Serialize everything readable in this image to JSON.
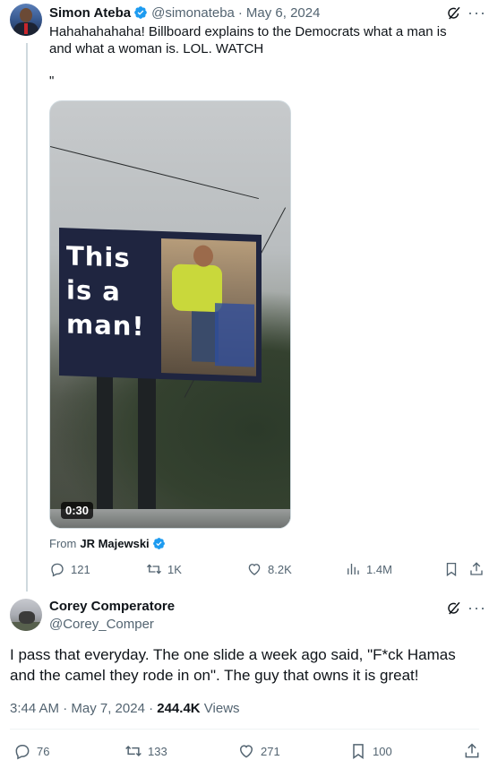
{
  "tweet1": {
    "author_name": "Simon Ateba",
    "handle": "@simonateba",
    "separator": "·",
    "date": "May 6, 2024",
    "text": "Hahahahahaha! Billboard explains to the Democrats what a man is and what a woman is. LOL. WATCH",
    "quote_mark": "\"",
    "video": {
      "billboard_text": "This is a man!",
      "duration": "0:30"
    },
    "from_label": "From",
    "from_name": "JR Majewski",
    "actions": {
      "replies": "121",
      "reposts": "1K",
      "likes": "8.2K",
      "views": "1.4M"
    }
  },
  "tweet2": {
    "author_name": "Corey Comperatore",
    "handle": "@Corey_Comper",
    "text": "I pass that everyday. The one slide a week ago said, \"F*ck Hamas and the camel they rode in on\".  The guy that owns it is great!",
    "time": "3:44 AM · May 7, 2024 · ",
    "views_count": "244.4K",
    "views_label": " Views",
    "actions": {
      "replies": "76",
      "reposts": "133",
      "likes": "271",
      "bookmarks": "100"
    }
  },
  "colors": {
    "verified": "#1d9bf0",
    "muted": "#536471",
    "text": "#0f1419"
  },
  "icons": [
    "verified-badge-icon",
    "grok-icon",
    "more-icon",
    "reply-icon",
    "repost-icon",
    "like-icon",
    "views-icon",
    "bookmark-icon",
    "share-icon"
  ]
}
